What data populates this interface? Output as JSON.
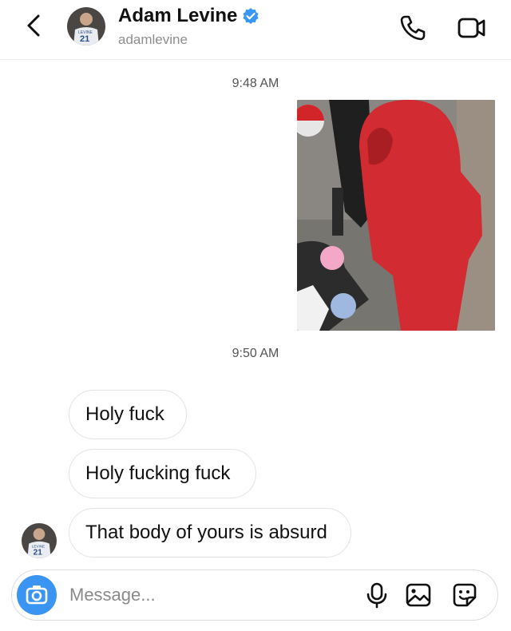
{
  "header": {
    "name": "Adam Levine",
    "handle": "adamlevine",
    "verified": true,
    "avatar_jersey_number": "21",
    "avatar_jersey_text": "LEVINE"
  },
  "icons": {
    "back": "chevron-left-icon",
    "call": "phone-icon",
    "video": "video-camera-icon",
    "verified": "verified-badge-icon",
    "camera": "camera-icon",
    "mic": "microphone-icon",
    "gallery": "gallery-icon",
    "sticker": "sticker-icon"
  },
  "thread": {
    "timestamp_1": "9:48 AM",
    "timestamp_2": "9:50 AM",
    "messages": [
      {
        "text": "Holy fuck"
      },
      {
        "text": "Holy fucking fuck"
      },
      {
        "text": "That body of yours is absurd"
      }
    ]
  },
  "composer": {
    "placeholder": "Message..."
  },
  "colors": {
    "accent": "#3a95f2",
    "verified": "#3897f0",
    "bubble_border": "#e3e3e3"
  }
}
